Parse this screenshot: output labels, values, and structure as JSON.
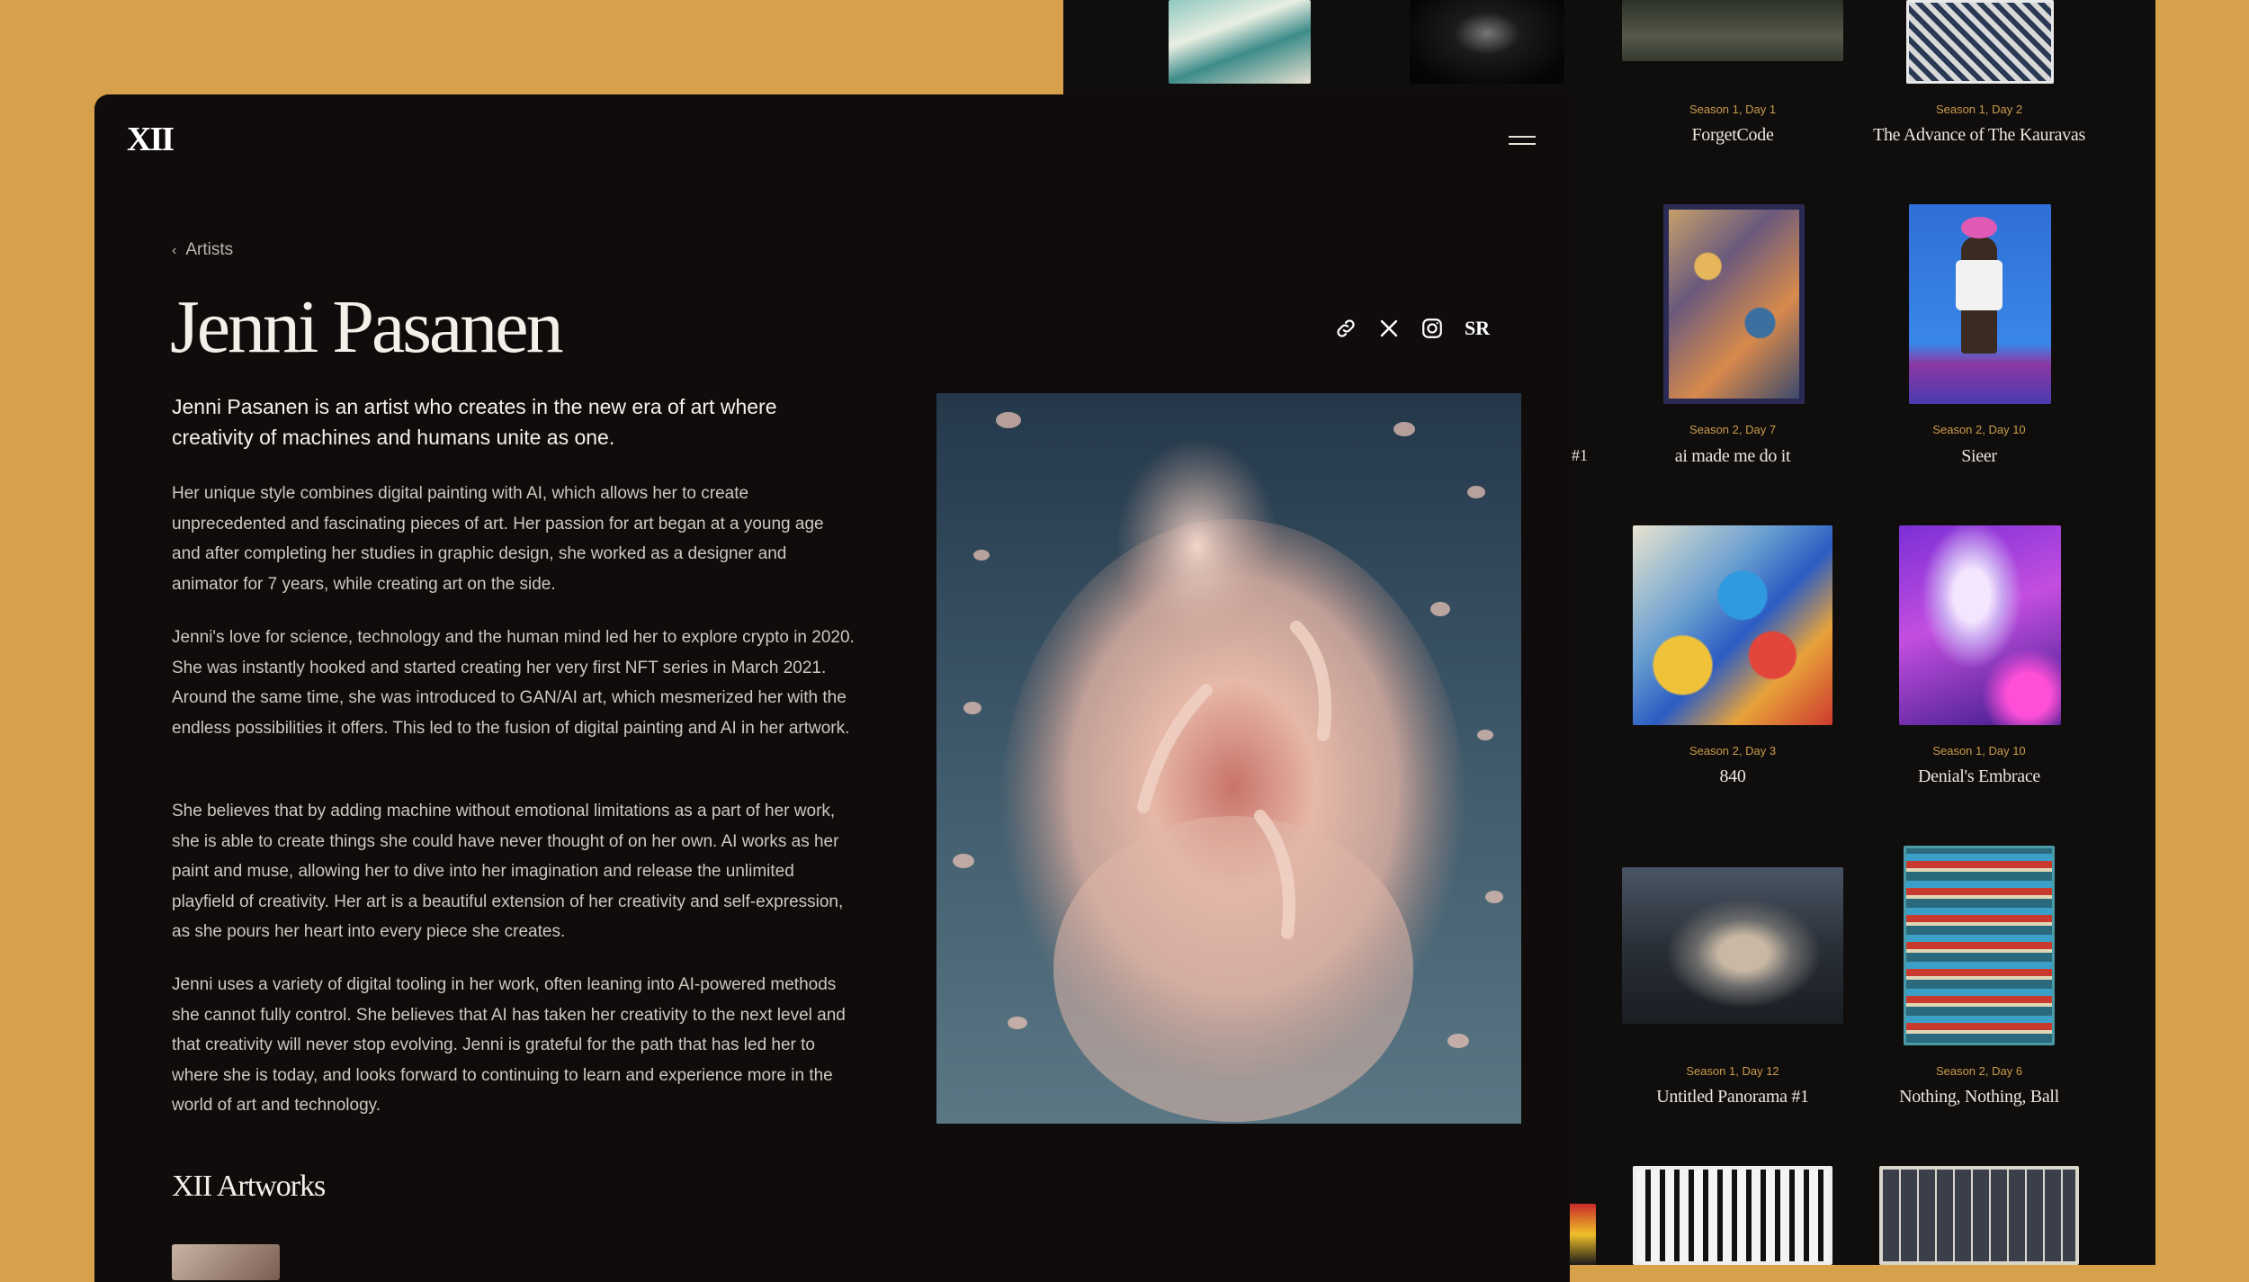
{
  "site": {
    "logo": "XII"
  },
  "breadcrumb": {
    "label": "Artists"
  },
  "artist": {
    "name": "Jenni Pasanen",
    "intro": "Jenni Pasanen is an artist who creates in the new era of art where creativity of machines and humans unite as one.",
    "paragraphs": [
      "Her unique style combines digital painting with AI, which allows her to create unprecedented and fascinating pieces of art. Her passion for art began at a young age and after completing her studies in graphic design, she worked as a designer and animator for 7 years, while creating art on the side.",
      "Jenni's love for science, technology and the human mind led her to explore crypto in 2020. She was instantly hooked and started creating her very first NFT series in March 2021. Around the same time, she was introduced to GAN/AI art, which mesmerized her with the endless possibilities it offers. This led to the fusion of digital painting and AI in her artwork.",
      "She believes that by adding machine without emotional limitations as a part of her work, she is able to create things she could have never thought of on her own. AI works as her paint and muse, allowing her to dive into her imagination and release the unlimited playfield of creativity. Her art is a beautiful extension of her creativity and self-expression, as she pours her heart into every piece she creates.",
      "Jenni uses a variety of digital tooling in her work, often leaning into AI-powered methods she cannot fully control. She believes that AI has taken her creativity to the next level and that creativity will never stop evolving. Jenni is grateful for the path that has led her to where she is today, and looks forward to continuing to learn and experience more in the world of art and technology."
    ],
    "socials": [
      "link-icon",
      "x-icon",
      "instagram-icon",
      "superrare-icon"
    ],
    "superrare_label": "SR"
  },
  "artworks_heading": "XII Artworks",
  "gallery": {
    "side_label": "#1",
    "items": [
      {
        "season": "Season 1, Day 1",
        "title": "ForgetCode"
      },
      {
        "season": "Season 1, Day 2",
        "title": "The Advance of The Kauravas"
      },
      {
        "season": "Season 2, Day 7",
        "title": "ai made me do it"
      },
      {
        "season": "Season 2, Day 10",
        "title": "Sieer"
      },
      {
        "season": "Season 2, Day 3",
        "title": "840"
      },
      {
        "season": "Season 1, Day 10",
        "title": "Denial's Embrace"
      },
      {
        "season": "Season 1, Day 12",
        "title": "Untitled Panorama #1"
      },
      {
        "season": "Season 2, Day 6",
        "title": "Nothing, Nothing, Ball"
      }
    ]
  },
  "colors": {
    "background": "#d7a04b",
    "panel": "#0f0c0b",
    "accent": "#c99c4a"
  }
}
